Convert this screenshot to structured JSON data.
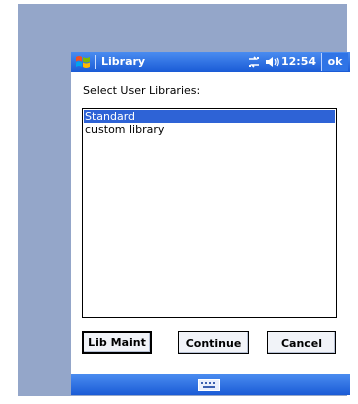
{
  "window": {
    "title": "Library",
    "time": "12:54",
    "ok_label": "ok",
    "icons": {
      "start": "windows-flag-icon",
      "connectivity": "connectivity-icon",
      "volume": "speaker-icon",
      "keyboard": "keyboard-icon"
    }
  },
  "dialog": {
    "prompt": "Select User Libraries:",
    "libraries": [
      {
        "label": "Standard",
        "selected": true
      },
      {
        "label": "custom library",
        "selected": false
      }
    ],
    "buttons": {
      "lib_maint": "Lib Maint",
      "continue": "Continue",
      "cancel": "Cancel"
    }
  },
  "colors": {
    "title_bar": "#1a5bd6",
    "selection": "#2e63d6",
    "frame": "#94a6c9"
  }
}
